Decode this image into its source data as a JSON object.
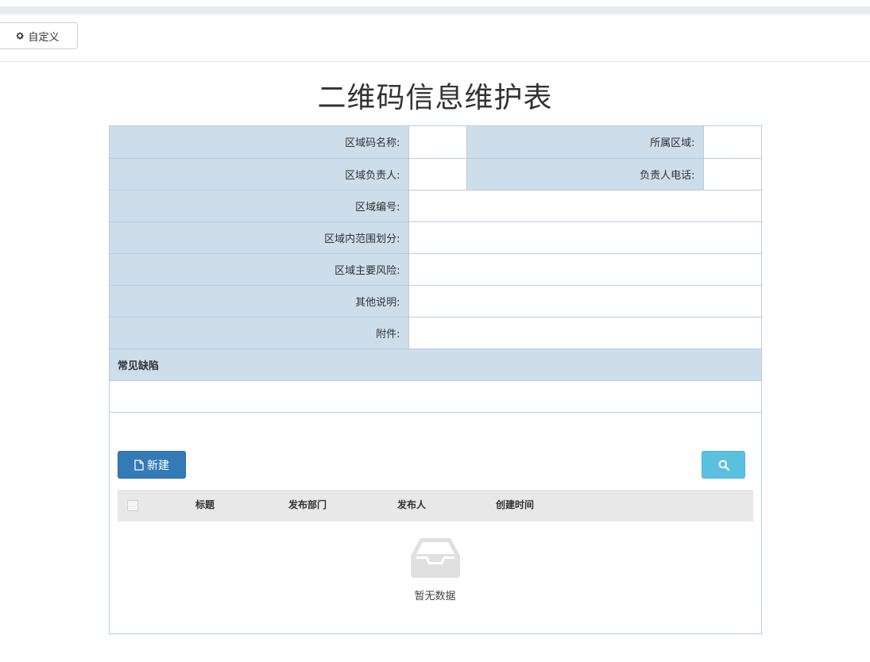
{
  "toolbar": {
    "customize_label": "自定义",
    "customize_icon": "gear-icon"
  },
  "page": {
    "title": "二维码信息维护表"
  },
  "form": {
    "area_code_name_label": "区域码名称:",
    "area_code_name_value": "",
    "belong_area_label": "所属区域:",
    "belong_area_value": "",
    "area_owner_label": "区域负责人:",
    "area_owner_value": "",
    "owner_phone_label": "负责人电话:",
    "owner_phone_value": "",
    "area_number_label": "区域编号:",
    "area_number_value": "",
    "scope_label": "区域内范围划分:",
    "scope_value": "",
    "risk_label": "区域主要风险:",
    "risk_value": "",
    "other_label": "其他说明:",
    "other_value": "",
    "attachment_label": "附件:",
    "attachment_value": ""
  },
  "defects": {
    "section_title": "常见缺陷",
    "new_label": "新建",
    "new_icon": "file-icon",
    "search_icon": "search-icon",
    "columns": [
      "标题",
      "发布部门",
      "发布人",
      "创建时间"
    ],
    "rows": [],
    "empty_text": "暂无数据",
    "empty_icon": "inbox-icon"
  },
  "colors": {
    "label_bg": "#cddeea",
    "border": "#b7cde3",
    "primary": "#337ab7",
    "info": "#5bc0de"
  }
}
